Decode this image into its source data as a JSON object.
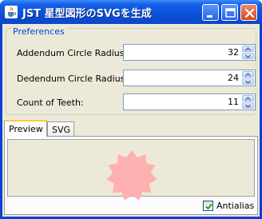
{
  "window": {
    "title": "JST 星型図形のSVGを生成",
    "icons": {
      "app": "java-cup-icon",
      "minimize": "minimize-icon",
      "maximize": "maximize-icon",
      "close": "close-icon"
    }
  },
  "preferences": {
    "group_title": "Preferences",
    "fields": [
      {
        "label": "Addendum Circle Radius:",
        "value": "32"
      },
      {
        "label": "Dedendum Circle Radius:",
        "value": "24"
      },
      {
        "label": "Count of Teeth:",
        "value": "11"
      }
    ]
  },
  "tabs": [
    {
      "label": "Preview",
      "selected": true
    },
    {
      "label": "SVG",
      "selected": false
    }
  ],
  "preview": {
    "star": {
      "points": 11,
      "outer_radius": 32,
      "inner_radius": 24,
      "fill": "#ffb0b0"
    }
  },
  "antialias": {
    "label": "Antialias",
    "checked": true
  },
  "colors": {
    "titlebar": "#0a4fd8",
    "group_title": "#0046d5",
    "tab_highlight": "#ffc83c",
    "star_fill": "#ffb0b0"
  }
}
